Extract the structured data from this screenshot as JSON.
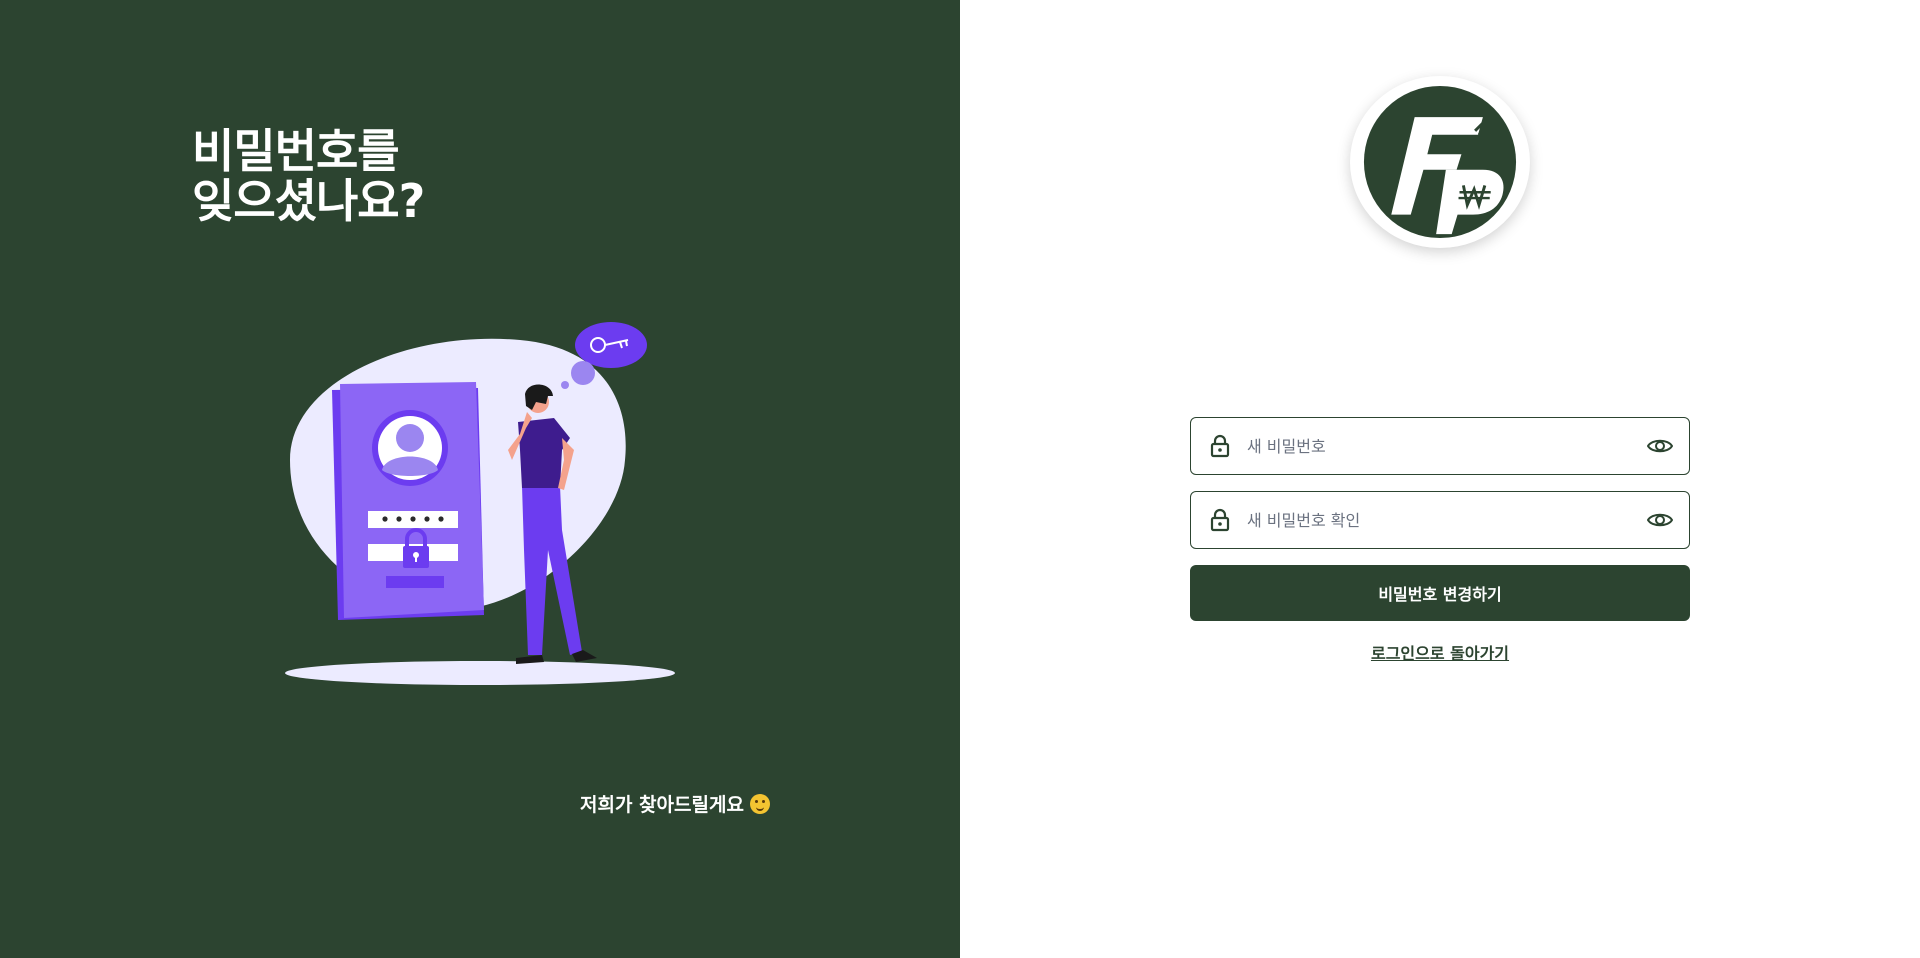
{
  "left": {
    "headline_line1": "비밀번호를",
    "headline_line2": "잊으셨나요?",
    "tagline": "저희가 찾아드릴게요"
  },
  "colors": {
    "brand_green": "#2c4430",
    "purple": "#7c4dff",
    "lavender": "#ecebff"
  },
  "form": {
    "new_password_placeholder": "새 비밀번호",
    "confirm_password_placeholder": "새 비밀번호 확인",
    "submit_label": "비밀번호 변경하기",
    "back_link": "로그인으로 돌아가기"
  },
  "icons": {
    "field_leading": "lock-icon",
    "field_trailing": "eye-icon",
    "tagline_emoji": "thinking-face-icon",
    "logo": "fp-logo"
  }
}
